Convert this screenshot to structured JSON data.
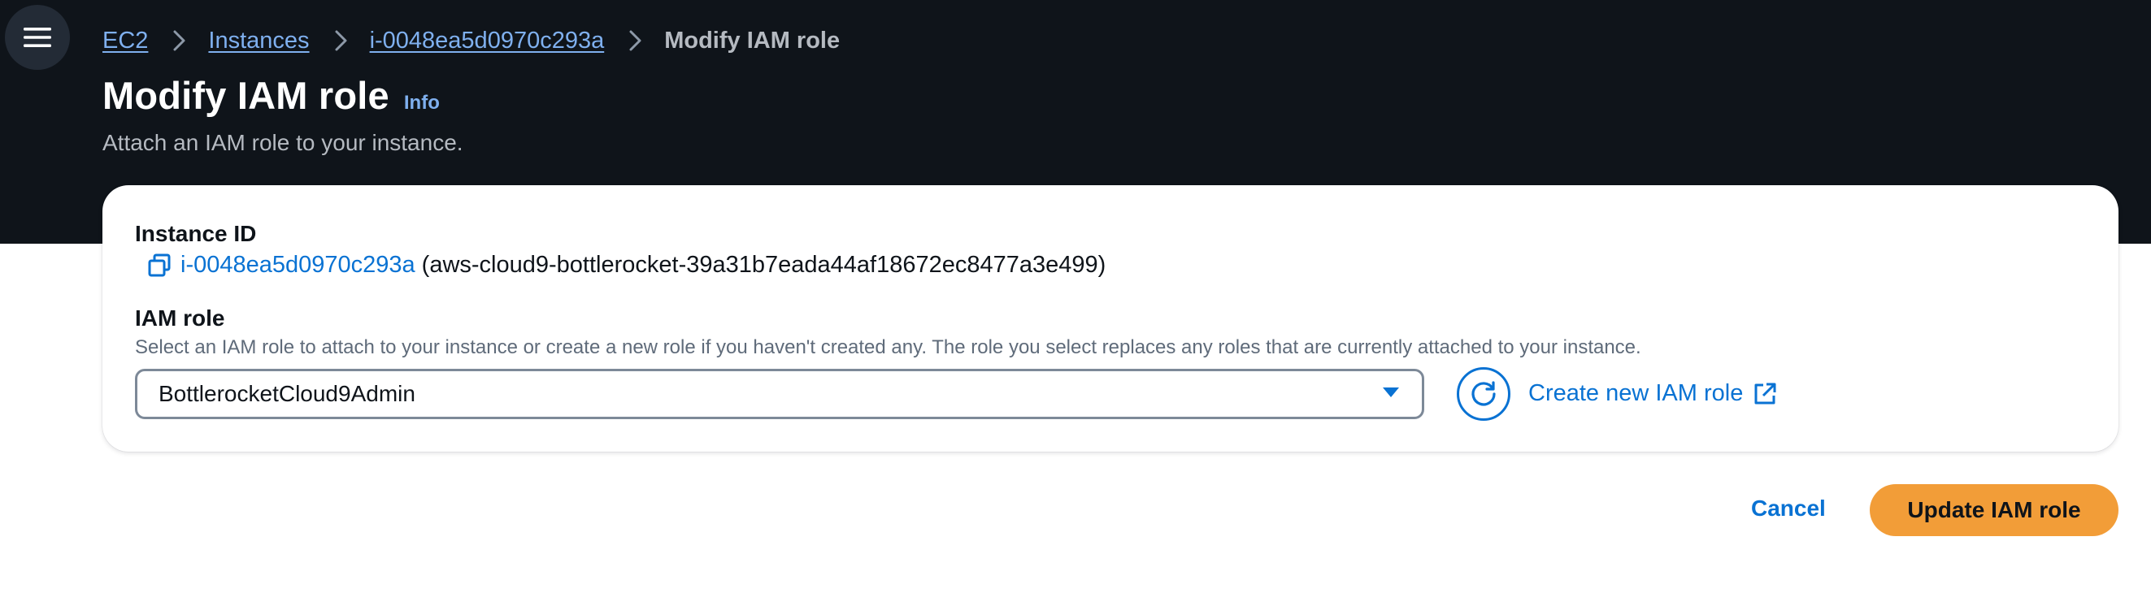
{
  "breadcrumb": {
    "items": [
      "EC2",
      "Instances",
      "i-0048ea5d0970c293a"
    ],
    "current": "Modify IAM role"
  },
  "header": {
    "title": "Modify IAM role",
    "info": "Info",
    "subtitle": "Attach an IAM role to your instance."
  },
  "instance": {
    "label": "Instance ID",
    "id": "i-0048ea5d0970c293a",
    "name": "(aws-cloud9-bottlerocket-39a31b7eada44af18672ec8477a3e499)"
  },
  "iam_role": {
    "label": "IAM role",
    "description": "Select an IAM role to attach to your instance or create a new role if you haven't created any. The role you select replaces any roles that are currently attached to your instance.",
    "selected": "BottlerocketCloud9Admin",
    "create_link": "Create new IAM role"
  },
  "actions": {
    "cancel": "Cancel",
    "submit": "Update IAM role"
  },
  "icons": {
    "menu": "hamburger-menu-icon",
    "copy": "copy-icon",
    "caret": "caret-down-icon",
    "refresh": "refresh-icon",
    "external": "external-link-icon"
  },
  "colors": {
    "header_bg": "#0f141a",
    "link": "#0972d3",
    "header_link": "#7fb0ef",
    "primary": "#f29d38"
  }
}
